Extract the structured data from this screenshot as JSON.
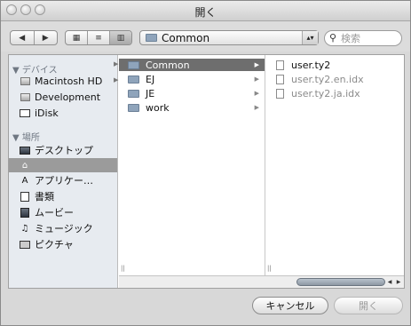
{
  "window": {
    "title": "開く",
    "traffic_lights": [
      "close",
      "minimize",
      "zoom"
    ]
  },
  "toolbar": {
    "back_icon": "◀",
    "forward_icon": "▶",
    "view_icons": [
      "icon-view-icon",
      "list-view-icon",
      "column-view-icon"
    ],
    "path_popup_value": "Common",
    "search_placeholder": "検索"
  },
  "sidebar": {
    "devices_header": "▼ デバイス",
    "devices": [
      {
        "label": "Macintosh HD",
        "icon": "hard-disk-icon"
      },
      {
        "label": "Development",
        "icon": "hard-disk-icon"
      },
      {
        "label": "iDisk",
        "icon": "idisk-icon"
      }
    ],
    "places_header": "▼ 場所",
    "places": [
      {
        "label": "デスクトップ",
        "icon": "desktop-icon"
      },
      {
        "label": "",
        "icon": "home-icon"
      },
      {
        "label": "アプリケー…",
        "icon": "applications-icon"
      },
      {
        "label": "書類",
        "icon": "documents-icon"
      },
      {
        "label": "ムービー",
        "icon": "movies-icon"
      },
      {
        "label": "ミュージック",
        "icon": "music-icon"
      },
      {
        "label": "ピクチャ",
        "icon": "pictures-icon"
      }
    ]
  },
  "browser": {
    "column1": [
      {
        "label": "Common",
        "type": "folder",
        "selected": true
      },
      {
        "label": "EJ",
        "type": "folder"
      },
      {
        "label": "JE",
        "type": "folder"
      },
      {
        "label": "work",
        "type": "folder"
      }
    ],
    "column2": [
      {
        "label": "user.ty2",
        "type": "file",
        "enabled": true
      },
      {
        "label": "user.ty2.en.idx",
        "type": "file",
        "enabled": false
      },
      {
        "label": "user.ty2.ja.idx",
        "type": "file",
        "enabled": false
      }
    ]
  },
  "buttons": {
    "cancel": "キャンセル",
    "open": "開く"
  }
}
